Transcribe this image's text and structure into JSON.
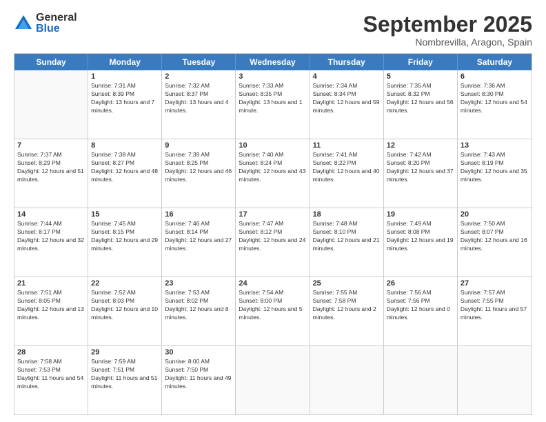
{
  "logo": {
    "general": "General",
    "blue": "Blue"
  },
  "title": "September 2025",
  "location": "Nombrevilla, Aragon, Spain",
  "days_of_week": [
    "Sunday",
    "Monday",
    "Tuesday",
    "Wednesday",
    "Thursday",
    "Friday",
    "Saturday"
  ],
  "weeks": [
    [
      {
        "day": "",
        "empty": true
      },
      {
        "day": "1",
        "sunrise": "7:31 AM",
        "sunset": "8:39 PM",
        "daylight": "13 hours and 7 minutes."
      },
      {
        "day": "2",
        "sunrise": "7:32 AM",
        "sunset": "8:37 PM",
        "daylight": "13 hours and 4 minutes."
      },
      {
        "day": "3",
        "sunrise": "7:33 AM",
        "sunset": "8:35 PM",
        "daylight": "13 hours and 1 minute."
      },
      {
        "day": "4",
        "sunrise": "7:34 AM",
        "sunset": "8:34 PM",
        "daylight": "12 hours and 59 minutes."
      },
      {
        "day": "5",
        "sunrise": "7:35 AM",
        "sunset": "8:32 PM",
        "daylight": "12 hours and 56 minutes."
      },
      {
        "day": "6",
        "sunrise": "7:36 AM",
        "sunset": "8:30 PM",
        "daylight": "12 hours and 54 minutes."
      }
    ],
    [
      {
        "day": "7",
        "sunrise": "7:37 AM",
        "sunset": "8:29 PM",
        "daylight": "12 hours and 51 minutes."
      },
      {
        "day": "8",
        "sunrise": "7:38 AM",
        "sunset": "8:27 PM",
        "daylight": "12 hours and 48 minutes."
      },
      {
        "day": "9",
        "sunrise": "7:39 AM",
        "sunset": "8:25 PM",
        "daylight": "12 hours and 46 minutes."
      },
      {
        "day": "10",
        "sunrise": "7:40 AM",
        "sunset": "8:24 PM",
        "daylight": "12 hours and 43 minutes."
      },
      {
        "day": "11",
        "sunrise": "7:41 AM",
        "sunset": "8:22 PM",
        "daylight": "12 hours and 40 minutes."
      },
      {
        "day": "12",
        "sunrise": "7:42 AM",
        "sunset": "8:20 PM",
        "daylight": "12 hours and 37 minutes."
      },
      {
        "day": "13",
        "sunrise": "7:43 AM",
        "sunset": "8:19 PM",
        "daylight": "12 hours and 35 minutes."
      }
    ],
    [
      {
        "day": "14",
        "sunrise": "7:44 AM",
        "sunset": "8:17 PM",
        "daylight": "12 hours and 32 minutes."
      },
      {
        "day": "15",
        "sunrise": "7:45 AM",
        "sunset": "8:15 PM",
        "daylight": "12 hours and 29 minutes."
      },
      {
        "day": "16",
        "sunrise": "7:46 AM",
        "sunset": "8:14 PM",
        "daylight": "12 hours and 27 minutes."
      },
      {
        "day": "17",
        "sunrise": "7:47 AM",
        "sunset": "8:12 PM",
        "daylight": "12 hours and 24 minutes."
      },
      {
        "day": "18",
        "sunrise": "7:48 AM",
        "sunset": "8:10 PM",
        "daylight": "12 hours and 21 minutes."
      },
      {
        "day": "19",
        "sunrise": "7:49 AM",
        "sunset": "8:08 PM",
        "daylight": "12 hours and 19 minutes."
      },
      {
        "day": "20",
        "sunrise": "7:50 AM",
        "sunset": "8:07 PM",
        "daylight": "12 hours and 16 minutes."
      }
    ],
    [
      {
        "day": "21",
        "sunrise": "7:51 AM",
        "sunset": "8:05 PM",
        "daylight": "12 hours and 13 minutes."
      },
      {
        "day": "22",
        "sunrise": "7:52 AM",
        "sunset": "8:03 PM",
        "daylight": "12 hours and 10 minutes."
      },
      {
        "day": "23",
        "sunrise": "7:53 AM",
        "sunset": "8:02 PM",
        "daylight": "12 hours and 8 minutes."
      },
      {
        "day": "24",
        "sunrise": "7:54 AM",
        "sunset": "8:00 PM",
        "daylight": "12 hours and 5 minutes."
      },
      {
        "day": "25",
        "sunrise": "7:55 AM",
        "sunset": "7:58 PM",
        "daylight": "12 hours and 2 minutes."
      },
      {
        "day": "26",
        "sunrise": "7:56 AM",
        "sunset": "7:56 PM",
        "daylight": "12 hours and 0 minutes."
      },
      {
        "day": "27",
        "sunrise": "7:57 AM",
        "sunset": "7:55 PM",
        "daylight": "11 hours and 57 minutes."
      }
    ],
    [
      {
        "day": "28",
        "sunrise": "7:58 AM",
        "sunset": "7:53 PM",
        "daylight": "11 hours and 54 minutes."
      },
      {
        "day": "29",
        "sunrise": "7:59 AM",
        "sunset": "7:51 PM",
        "daylight": "11 hours and 51 minutes."
      },
      {
        "day": "30",
        "sunrise": "8:00 AM",
        "sunset": "7:50 PM",
        "daylight": "11 hours and 49 minutes."
      },
      {
        "day": "",
        "empty": true
      },
      {
        "day": "",
        "empty": true
      },
      {
        "day": "",
        "empty": true
      },
      {
        "day": "",
        "empty": true
      }
    ]
  ]
}
